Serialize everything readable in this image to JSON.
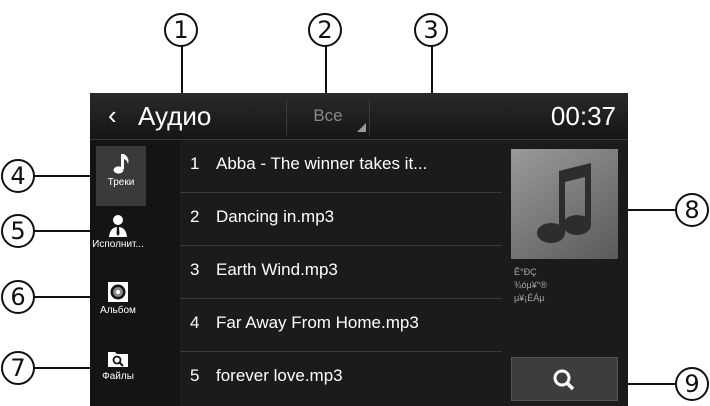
{
  "header": {
    "back_glyph": "‹",
    "title": "Аудио",
    "filter_value": "Все",
    "time": "00:37"
  },
  "sidebar": {
    "items": [
      {
        "label": "Треки",
        "icon": "music-note-icon",
        "active": true
      },
      {
        "label": "Исполнит...",
        "icon": "artist-icon",
        "active": false
      },
      {
        "label": "Альбом",
        "icon": "album-disc-icon",
        "active": false
      },
      {
        "label": "Файлы",
        "icon": "folder-search-icon",
        "active": false
      }
    ]
  },
  "tracks": [
    {
      "num": "1",
      "title": "Abba - The winner takes it..."
    },
    {
      "num": "2",
      "title": "Dancing in.mp3"
    },
    {
      "num": "3",
      "title": "Earth Wind.mp3"
    },
    {
      "num": "4",
      "title": "Far Away From Home.mp3"
    },
    {
      "num": "5",
      "title": "forever love.mp3"
    }
  ],
  "now_playing": {
    "meta_lines": [
      "Ê°ÐÇ",
      "¾óµ¥°®",
      "µ¥¡ÉÁµ"
    ]
  },
  "callouts": [
    "1",
    "2",
    "3",
    "4",
    "5",
    "6",
    "7",
    "8",
    "9"
  ],
  "colors": {
    "screen_bg": "#1b1b1b",
    "text": "#ffffff",
    "muted": "#8a8a8a"
  }
}
